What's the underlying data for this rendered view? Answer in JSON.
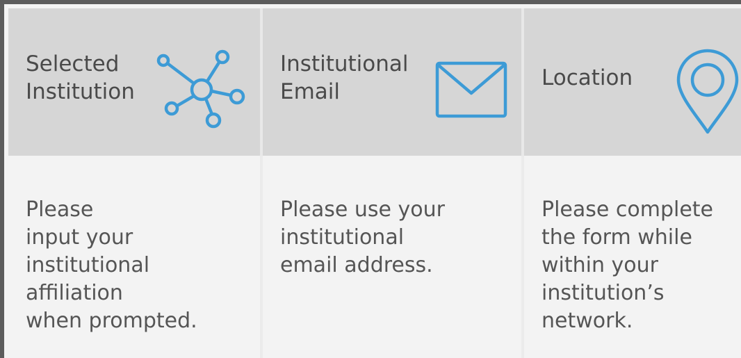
{
  "accent_color": "#3d9bd6",
  "columns": [
    {
      "title": "Selected\nInstitution",
      "icon": "network-icon",
      "description": "Please\ninput your\ninstitutional\naffiliation\nwhen prompted."
    },
    {
      "title": "Institutional\nEmail",
      "icon": "envelope-icon",
      "description": "Please use your\ninstitutional\nemail address."
    },
    {
      "title": "Location",
      "icon": "location-pin-icon",
      "description": "Please complete\nthe form while\nwithin your\ninstitution’s\nnetwork."
    }
  ]
}
